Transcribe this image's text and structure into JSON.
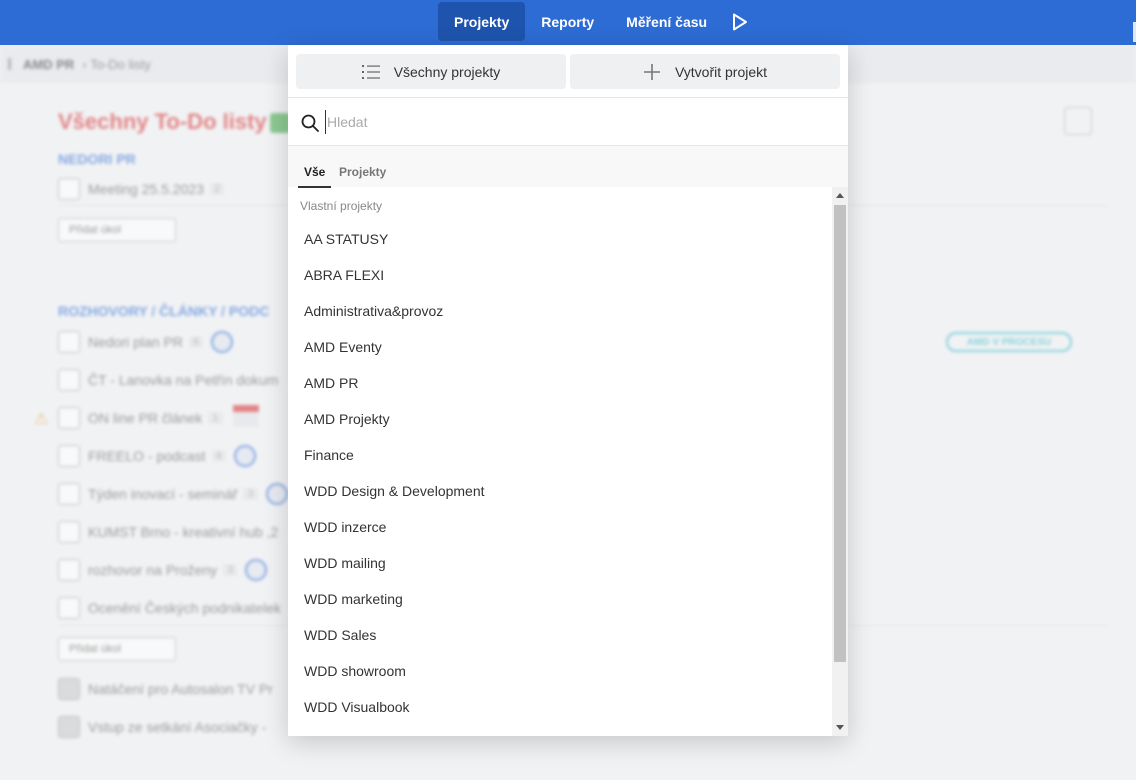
{
  "nav": {
    "items": [
      {
        "label": "Projekty",
        "active": true
      },
      {
        "label": "Reporty"
      },
      {
        "label": "Měření času"
      }
    ]
  },
  "background": {
    "breadcrumb": [
      "AMD PR",
      "To-Do listy"
    ],
    "title": "Všechny To-Do listy",
    "sections": [
      "NEDORI PR",
      "ROZHOVORY / ČLÁNKY / PODC"
    ],
    "tasks_first": [
      {
        "label": "Meeting 25.5.2023",
        "count": "2"
      }
    ],
    "tasks_second": [
      {
        "label": "Nedori plan PR",
        "count": "6"
      },
      {
        "label": "ČT - Lanovka na Petřín dokum"
      },
      {
        "label": "ON line PR článek",
        "count": "1"
      },
      {
        "label": "FREELO - podcast",
        "count": "4"
      },
      {
        "label": "Týden inovací - seminář",
        "count": "3"
      },
      {
        "label": "KUMST Brno - kreativní hub ,2"
      },
      {
        "label": "rozhovor na Proženy",
        "count": "3"
      },
      {
        "label": "Ocenění Českých podnikatelek"
      }
    ],
    "tasks_done": [
      {
        "label": "Natáčení pro Autosalon TV Pr"
      },
      {
        "label": "Vstup ze setkání Asociačky -"
      }
    ],
    "add_task_label": "Přidat úkol",
    "status_pill": "AMD V PROCESU",
    "date_label": "11."
  },
  "panel": {
    "all_projects_label": "Všechny projekty",
    "create_project_label": "Vytvořit projekt",
    "search_placeholder": "Hledat",
    "tabs": [
      {
        "label": "Vše",
        "active": true
      },
      {
        "label": "Projekty"
      }
    ],
    "list_heading": "Vlastní projekty",
    "projects": [
      "AA STATUSY",
      "ABRA FLEXI",
      "Administrativa&provoz",
      "AMD Eventy",
      "AMD PR",
      "AMD Projekty",
      "Finance",
      "WDD Design & Development",
      "WDD inzerce",
      "WDD mailing",
      "WDD marketing",
      "WDD Sales",
      "WDD showroom",
      "WDD Visualbook"
    ]
  },
  "colors": {
    "nav_bg": "#2d6cd4",
    "nav_active": "#1e54ad",
    "title_red": "#d62c2c"
  }
}
